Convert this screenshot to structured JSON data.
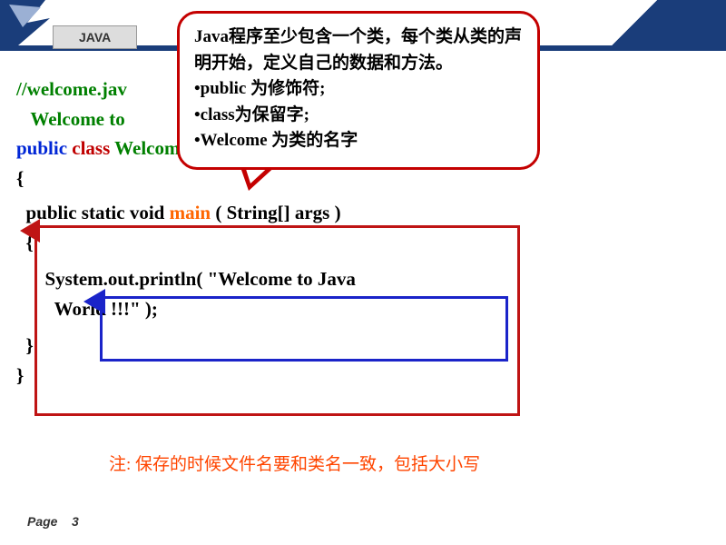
{
  "header": {
    "tag": "JAVA"
  },
  "callout": {
    "line1": "Java程序至少包含一个类，每个类从类的声明开始，定义自己的数据和方法。",
    "b1": "•public 为修饰符;",
    "b2": "•class为保留字;",
    "b3": "•Welcome 为类的名字"
  },
  "code": {
    "comment": "//welcome.jav",
    "comment2": "   Welcome to",
    "public": "public",
    "class": "class",
    "classname": "Welcom",
    "obrace": "{",
    "m_pre": "  public static void ",
    "m_main": "main",
    "m_args": " ( String[] args )",
    "m_obrace": "  {",
    "stmt1": "      System.out.println( \"Welcome to Java",
    "stmt2": "        World !!!\" );",
    "m_cbrace": "  }",
    "cbrace": "}"
  },
  "note": "注: 保存的时候文件名要和类名一致，包括大小写",
  "footer": {
    "page_label": "Page",
    "page_num": "3"
  }
}
